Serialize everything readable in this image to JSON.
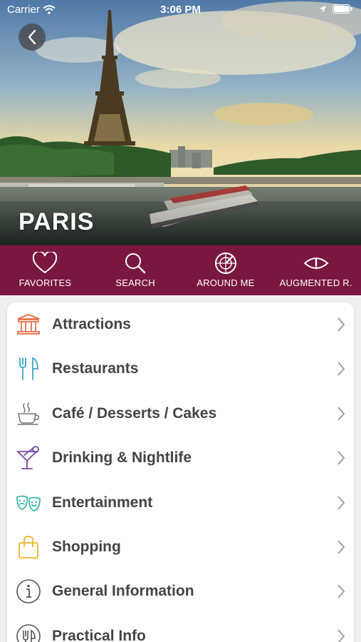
{
  "status_bar": {
    "carrier": "Carrier",
    "time": "3:06 PM"
  },
  "hero": {
    "city": "PARIS"
  },
  "toolbar": {
    "background": "#7a1741",
    "items": [
      {
        "label": "FAVORITES",
        "icon": "heart-icon"
      },
      {
        "label": "SEARCH",
        "icon": "search-icon"
      },
      {
        "label": "AROUND ME",
        "icon": "radar-icon"
      },
      {
        "label": "AUGMENTED R.",
        "icon": "eye-icon"
      }
    ]
  },
  "categories": [
    {
      "label": "Attractions",
      "icon": "museum-icon",
      "color": "#e8704a"
    },
    {
      "label": "Restaurants",
      "icon": "fork-knife-icon",
      "color": "#3aa7c8"
    },
    {
      "label": "Café / Desserts / Cakes",
      "icon": "coffee-cup-icon",
      "color": "#777777"
    },
    {
      "label": "Drinking & Nightlife",
      "icon": "cocktail-icon",
      "color": "#7b4aa0"
    },
    {
      "label": "Entertainment",
      "icon": "theater-masks-icon",
      "color": "#3fb6a8"
    },
    {
      "label": "Shopping",
      "icon": "shopping-bag-icon",
      "color": "#f0b429"
    },
    {
      "label": "General Information",
      "icon": "info-icon",
      "color": "#555555"
    },
    {
      "label": "Practical Info",
      "icon": "practical-info-icon",
      "color": "#555555"
    }
  ]
}
